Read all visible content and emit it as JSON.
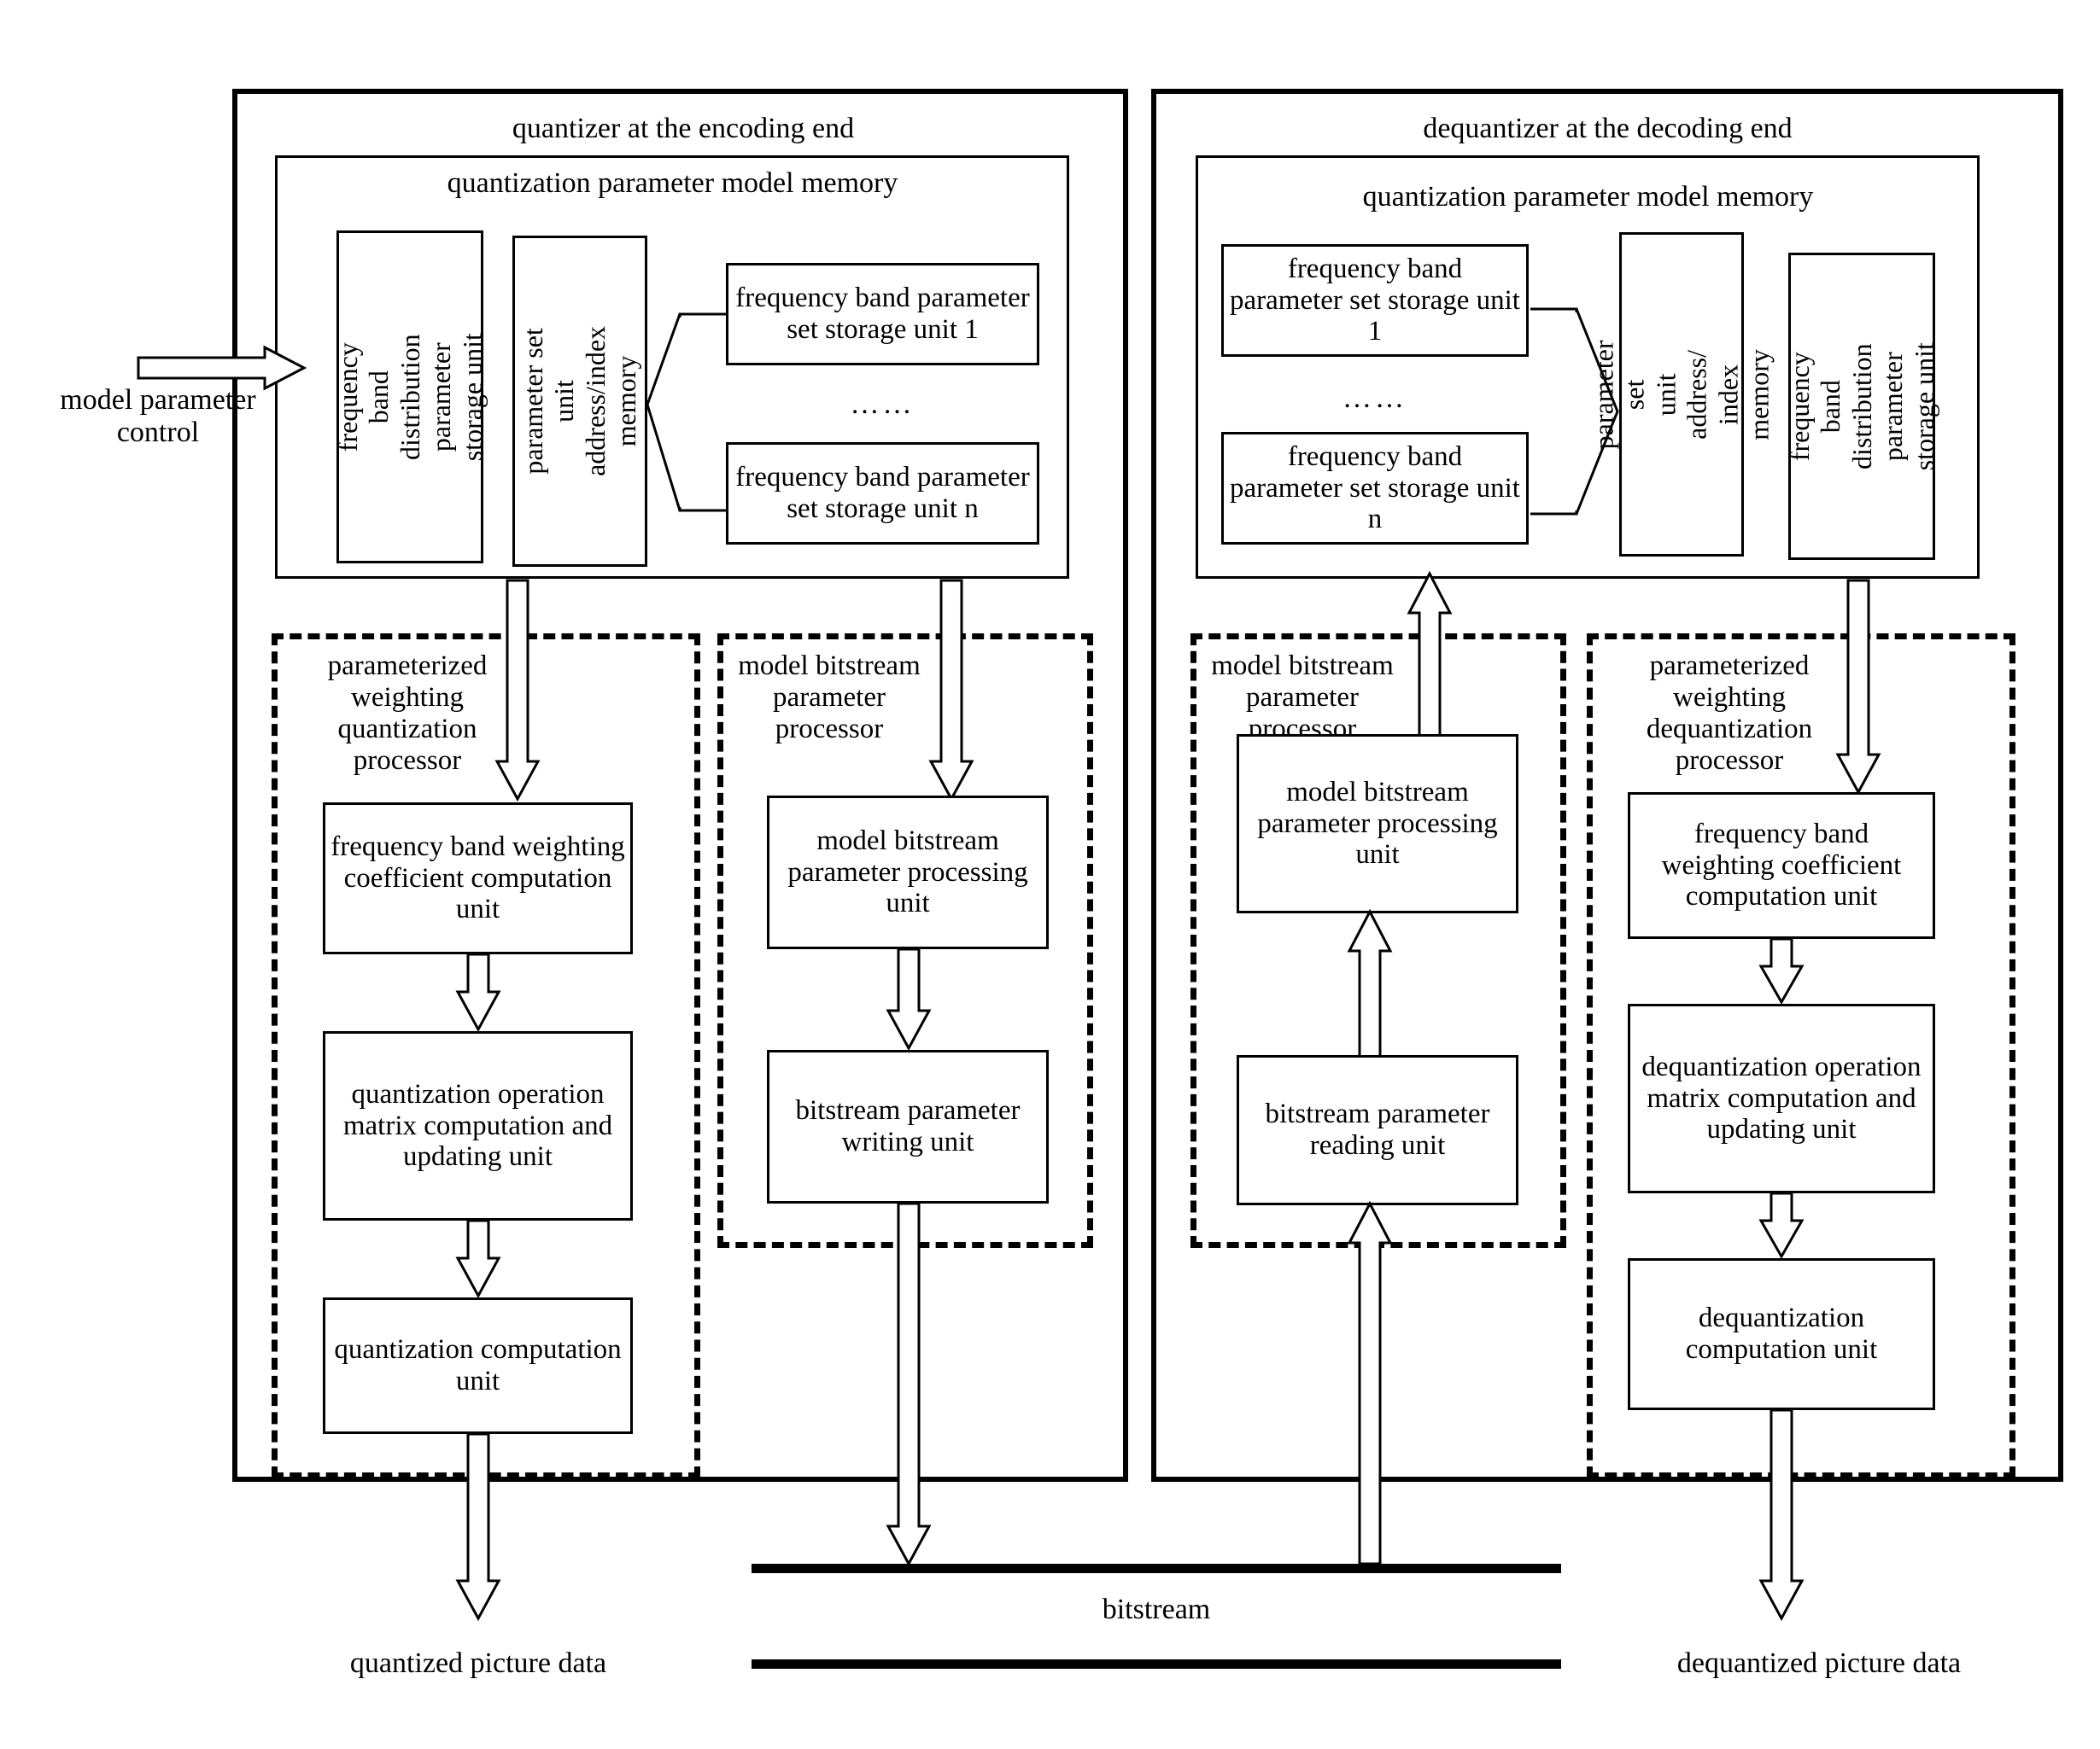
{
  "diagram": {
    "encoder_panel": {
      "title": "quantizer at the encoding end",
      "memory": {
        "title": "quantization parameter model memory",
        "freq_band_distribution_box": "frequency band\ndistribution\nparameter\nstorage unit",
        "param_set_addr_box": "parameter set unit\naddress/index\nmemory",
        "storage_unit_first": "frequency band\nparameter set\nstorage unit 1",
        "ellipsis": "……",
        "storage_unit_last": "frequency band\nparameter set\nstorage unit n"
      },
      "quant_processor": {
        "group_label": "parameterized\nweighting\nquantization\nprocessor",
        "units": [
          "frequency band\nweighting\ncoefficient\ncomputation unit",
          "quantization\noperation matrix\ncomputation and\nupdating unit",
          "quantization\ncomputation unit"
        ]
      },
      "bitstream_processor": {
        "group_label": "model\nbitstream\nparameter\nprocessor",
        "units": [
          "model bitstream\nparameter\nprocessing unit",
          "bitstream\nparameter\nwriting unit"
        ]
      }
    },
    "decoder_panel": {
      "title": "dequantizer at the decoding end",
      "memory": {
        "title": "quantization parameter model memory",
        "storage_unit_first": "frequency band\nparameter set\nstorage unit 1",
        "ellipsis": "……",
        "storage_unit_last": "frequency band\nparameter set\nstorage unit n",
        "param_set_addr_box": "parameter set\nunit address/\nindex memory",
        "freq_band_distribution_box": "frequency band\ndistribution\nparameter\nstorage unit"
      },
      "bitstream_processor": {
        "group_label": "model\nbitstream\nparameter\nprocessor",
        "units": [
          "model bitstream\nparameter\nprocessing unit",
          "bitstream\nparameter\nreading unit"
        ]
      },
      "dequant_processor": {
        "group_label": "parameterized\nweighting\ndequantization\nprocessor",
        "units": [
          "frequency band\nweighting\ncoefficient\ncomputation unit",
          "dequantization\noperation matrix\ncomputation and\nupdating unit",
          "dequantization\ncomputation unit"
        ]
      }
    },
    "io_labels": {
      "model_parameter_control": "model parameter\ncontrol",
      "quantized_picture_data": "quantized picture data",
      "bitstream": "bitstream",
      "dequantized_picture_data": "dequantized picture data"
    },
    "colors": {
      "stroke": "#000000",
      "background": "#ffffff"
    }
  }
}
